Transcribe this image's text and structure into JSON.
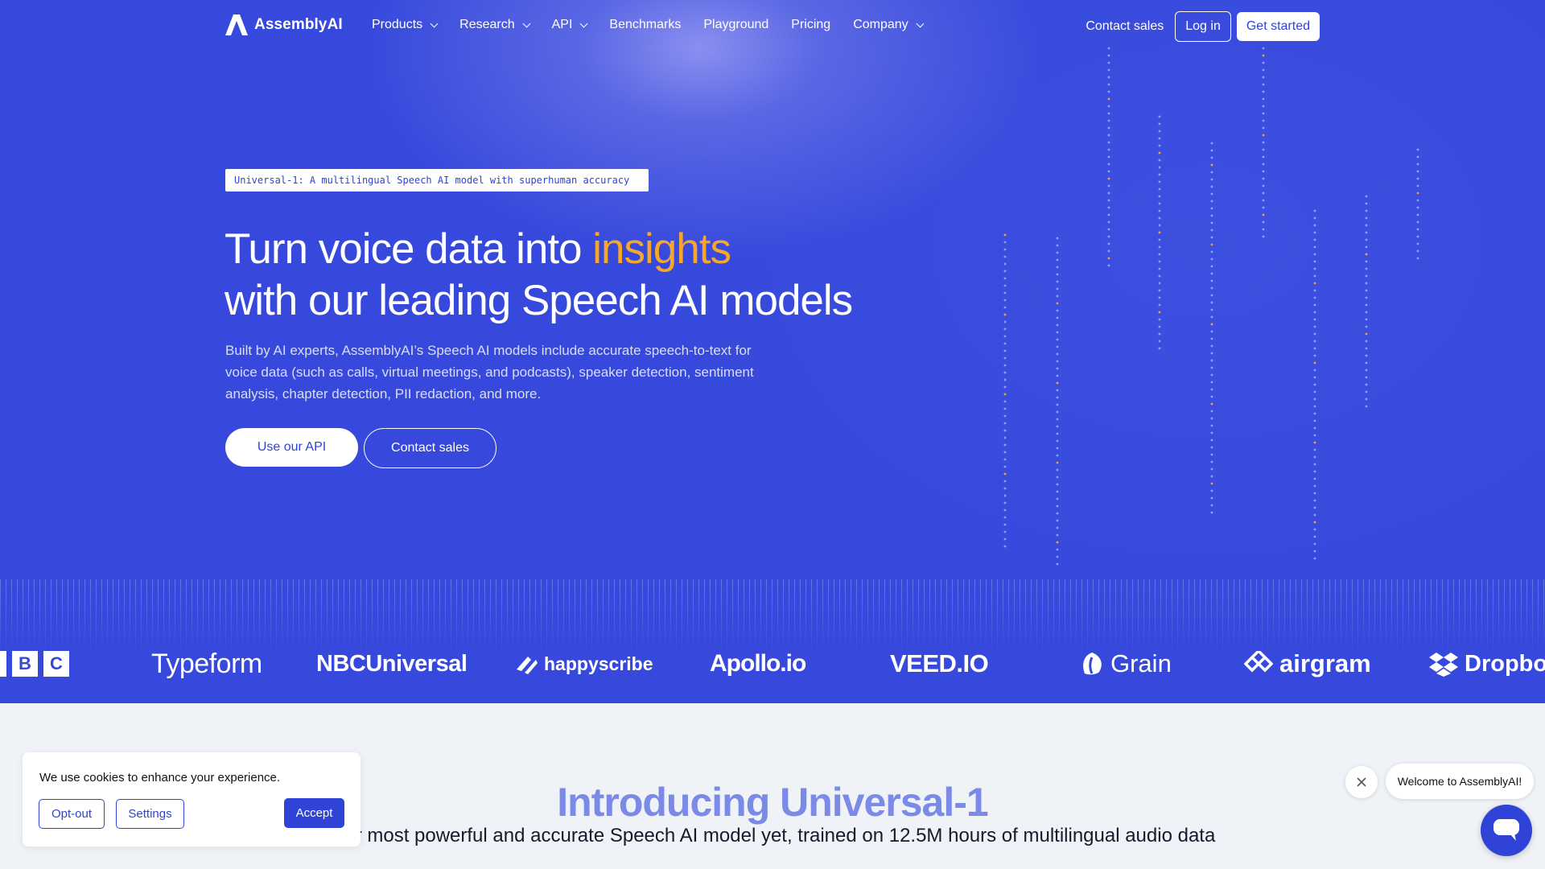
{
  "brand": {
    "name": "AssemblyAI"
  },
  "nav": {
    "links": [
      {
        "label": "Products",
        "dropdown": true
      },
      {
        "label": "Research",
        "dropdown": true
      },
      {
        "label": "API",
        "dropdown": true
      },
      {
        "label": "Benchmarks",
        "dropdown": false
      },
      {
        "label": "Playground",
        "dropdown": false
      },
      {
        "label": "Pricing",
        "dropdown": false
      },
      {
        "label": "Company",
        "dropdown": true
      }
    ],
    "contact_sales": "Contact sales",
    "login": "Log in",
    "get_started": "Get started"
  },
  "hero": {
    "badge": "Universal-1: A multilingual Speech AI model with superhuman accuracy",
    "headline_part1": "Turn voice data into ",
    "headline_accent": "insights",
    "headline_line2": "with our leading Speech AI models",
    "description": "Built by AI experts, AssemblyAI’s Speech AI models include accurate speech-to-text for voice data (such as calls, virtual meetings, and podcasts), speaker detection, sentiment analysis, chapter detection, PII redaction, and more.",
    "cta_primary": "Use our API",
    "cta_secondary": "Contact sales"
  },
  "logos": {
    "bbc": [
      "B",
      "B",
      "C"
    ],
    "typeform": "Typeform",
    "nbcuniversal": "NBCUniversal",
    "happyscribe": "happyscribe",
    "apollo": "Apollo.io",
    "veed": "VEED.IO",
    "grain": "Grain",
    "airgram": "airgram",
    "dropbox": "Dropbo"
  },
  "intro": {
    "title": "Introducing Universal-1",
    "subtitle": "Our most powerful and accurate Speech AI model yet, trained on 12.5M hours of multilingual audio data"
  },
  "cookie": {
    "text": "We use cookies to enhance your experience.",
    "optout": "Opt-out",
    "settings": "Settings",
    "accept": "Accept"
  },
  "chat": {
    "welcome": "Welcome to AssemblyAI!"
  },
  "colors": {
    "hero_bg": "#3649dc",
    "accent": "#f6a72b",
    "primary": "#2f44d6",
    "intro_title": "#7a8ae6"
  }
}
